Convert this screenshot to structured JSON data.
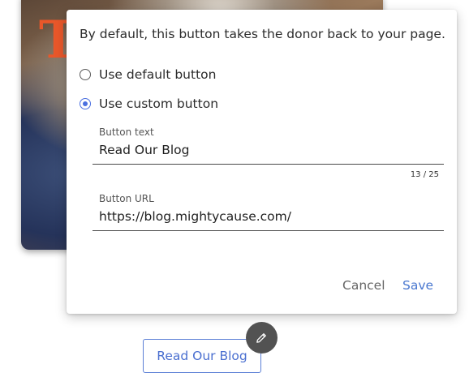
{
  "dialog": {
    "description": "By default, this button takes the donor back to your page.",
    "options": [
      {
        "label": "Use default button",
        "selected": false
      },
      {
        "label": "Use custom button",
        "selected": true
      }
    ],
    "button_text": {
      "label": "Button text",
      "value": "Read Our Blog",
      "counter": "13 / 25"
    },
    "button_url": {
      "label": "Button URL",
      "value": "https://blog.mightycause.com/"
    },
    "cancel_label": "Cancel",
    "save_label": "Save"
  },
  "background": {
    "glyph": "T"
  },
  "preview": {
    "button_label": "Read Our Blog",
    "edit_icon": "pencil-icon"
  },
  "colors": {
    "accent": "#4a6fe0",
    "save": "#4a78d0",
    "fab": "#525252"
  }
}
